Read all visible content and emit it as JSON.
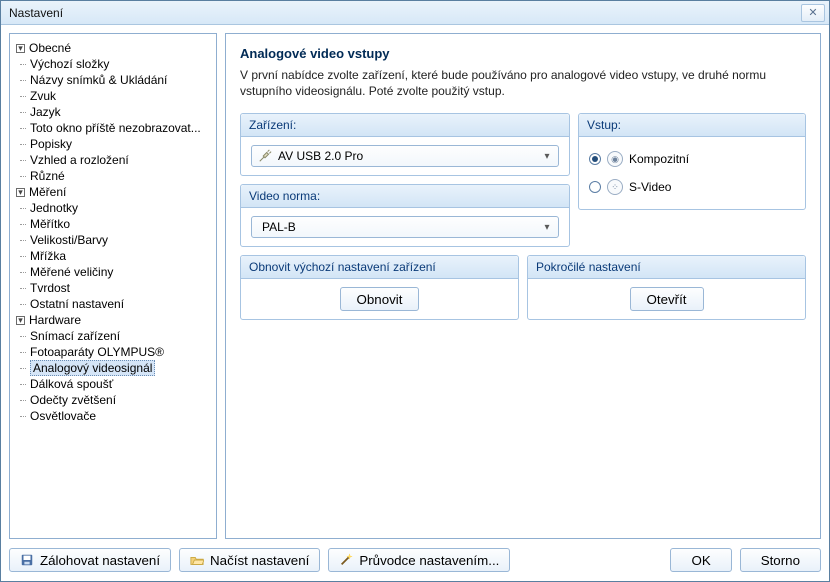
{
  "window": {
    "title": "Nastavení"
  },
  "tree": {
    "groups": [
      {
        "label": "Obecné",
        "items": [
          "Výchozí složky",
          "Názvy snímků & Ukládání",
          "Zvuk",
          "Jazyk",
          "Toto okno příště nezobrazovat...",
          "Popisky",
          "Vzhled a rozložení",
          "Různé"
        ]
      },
      {
        "label": "Měření",
        "items": [
          "Jednotky",
          "Měřítko",
          "Velikosti/Barvy",
          "Mřížka",
          "Měřené veličiny",
          "Tvrdost",
          "Ostatní nastavení"
        ]
      },
      {
        "label": "Hardware",
        "items": [
          "Snímací zařízení",
          "Fotoaparáty OLYMPUS®",
          "Analogový videosignál",
          "Dálková spoušť",
          "Odečty zvětšení",
          "Osvětlovače"
        ]
      }
    ],
    "selected": "Analogový videosignál"
  },
  "main": {
    "heading": "Analogové video vstupy",
    "description": "V první nabídce zvolte zařízení, které bude používáno pro analogové video vstupy, ve druhé normu vstupního videosignálu. Poté zvolte použitý vstup.",
    "device_group": "Zařízení:",
    "device_value": "AV USB 2.0 Pro",
    "norm_group": "Video norma:",
    "norm_value": "PAL-B",
    "input_group": "Vstup:",
    "input_composite": "Kompozitní",
    "input_svideo": "S-Video",
    "restore_group": "Obnovit výchozí nastavení zařízení",
    "restore_btn": "Obnovit",
    "advanced_group": "Pokročilé nastavení",
    "advanced_btn": "Otevřít"
  },
  "bottom": {
    "backup": "Zálohovat nastavení",
    "load": "Načíst nastavení",
    "wizard": "Průvodce nastavením...",
    "ok": "OK",
    "cancel": "Storno"
  }
}
